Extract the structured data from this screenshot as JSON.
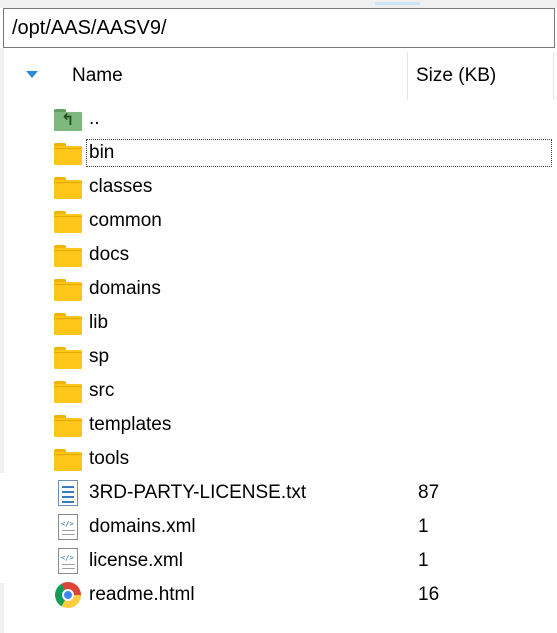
{
  "path": "/opt/AAS/AASV9/",
  "columns": {
    "name": "Name",
    "size": "Size (KB)"
  },
  "rows": [
    {
      "name": "..",
      "size": "",
      "icon": "parent-folder-icon"
    },
    {
      "name": "bin",
      "size": "",
      "icon": "folder-icon"
    },
    {
      "name": "classes",
      "size": "",
      "icon": "folder-icon"
    },
    {
      "name": "common",
      "size": "",
      "icon": "folder-icon"
    },
    {
      "name": "docs",
      "size": "",
      "icon": "folder-icon"
    },
    {
      "name": "domains",
      "size": "",
      "icon": "folder-icon"
    },
    {
      "name": "lib",
      "size": "",
      "icon": "folder-icon"
    },
    {
      "name": "sp",
      "size": "",
      "icon": "folder-icon"
    },
    {
      "name": "src",
      "size": "",
      "icon": "folder-icon"
    },
    {
      "name": "templates",
      "size": "",
      "icon": "folder-icon"
    },
    {
      "name": "tools",
      "size": "",
      "icon": "folder-icon"
    },
    {
      "name": "3RD-PARTY-LICENSE.txt",
      "size": "87",
      "icon": "text-file-icon"
    },
    {
      "name": "domains.xml",
      "size": "1",
      "icon": "xml-file-icon"
    },
    {
      "name": "license.xml",
      "size": "1",
      "icon": "xml-file-icon"
    },
    {
      "name": "readme.html",
      "size": "16",
      "icon": "chrome-html-icon"
    }
  ],
  "colors": {
    "folder": "#ffc61a",
    "sort_arrow": "#2a8ad4"
  }
}
